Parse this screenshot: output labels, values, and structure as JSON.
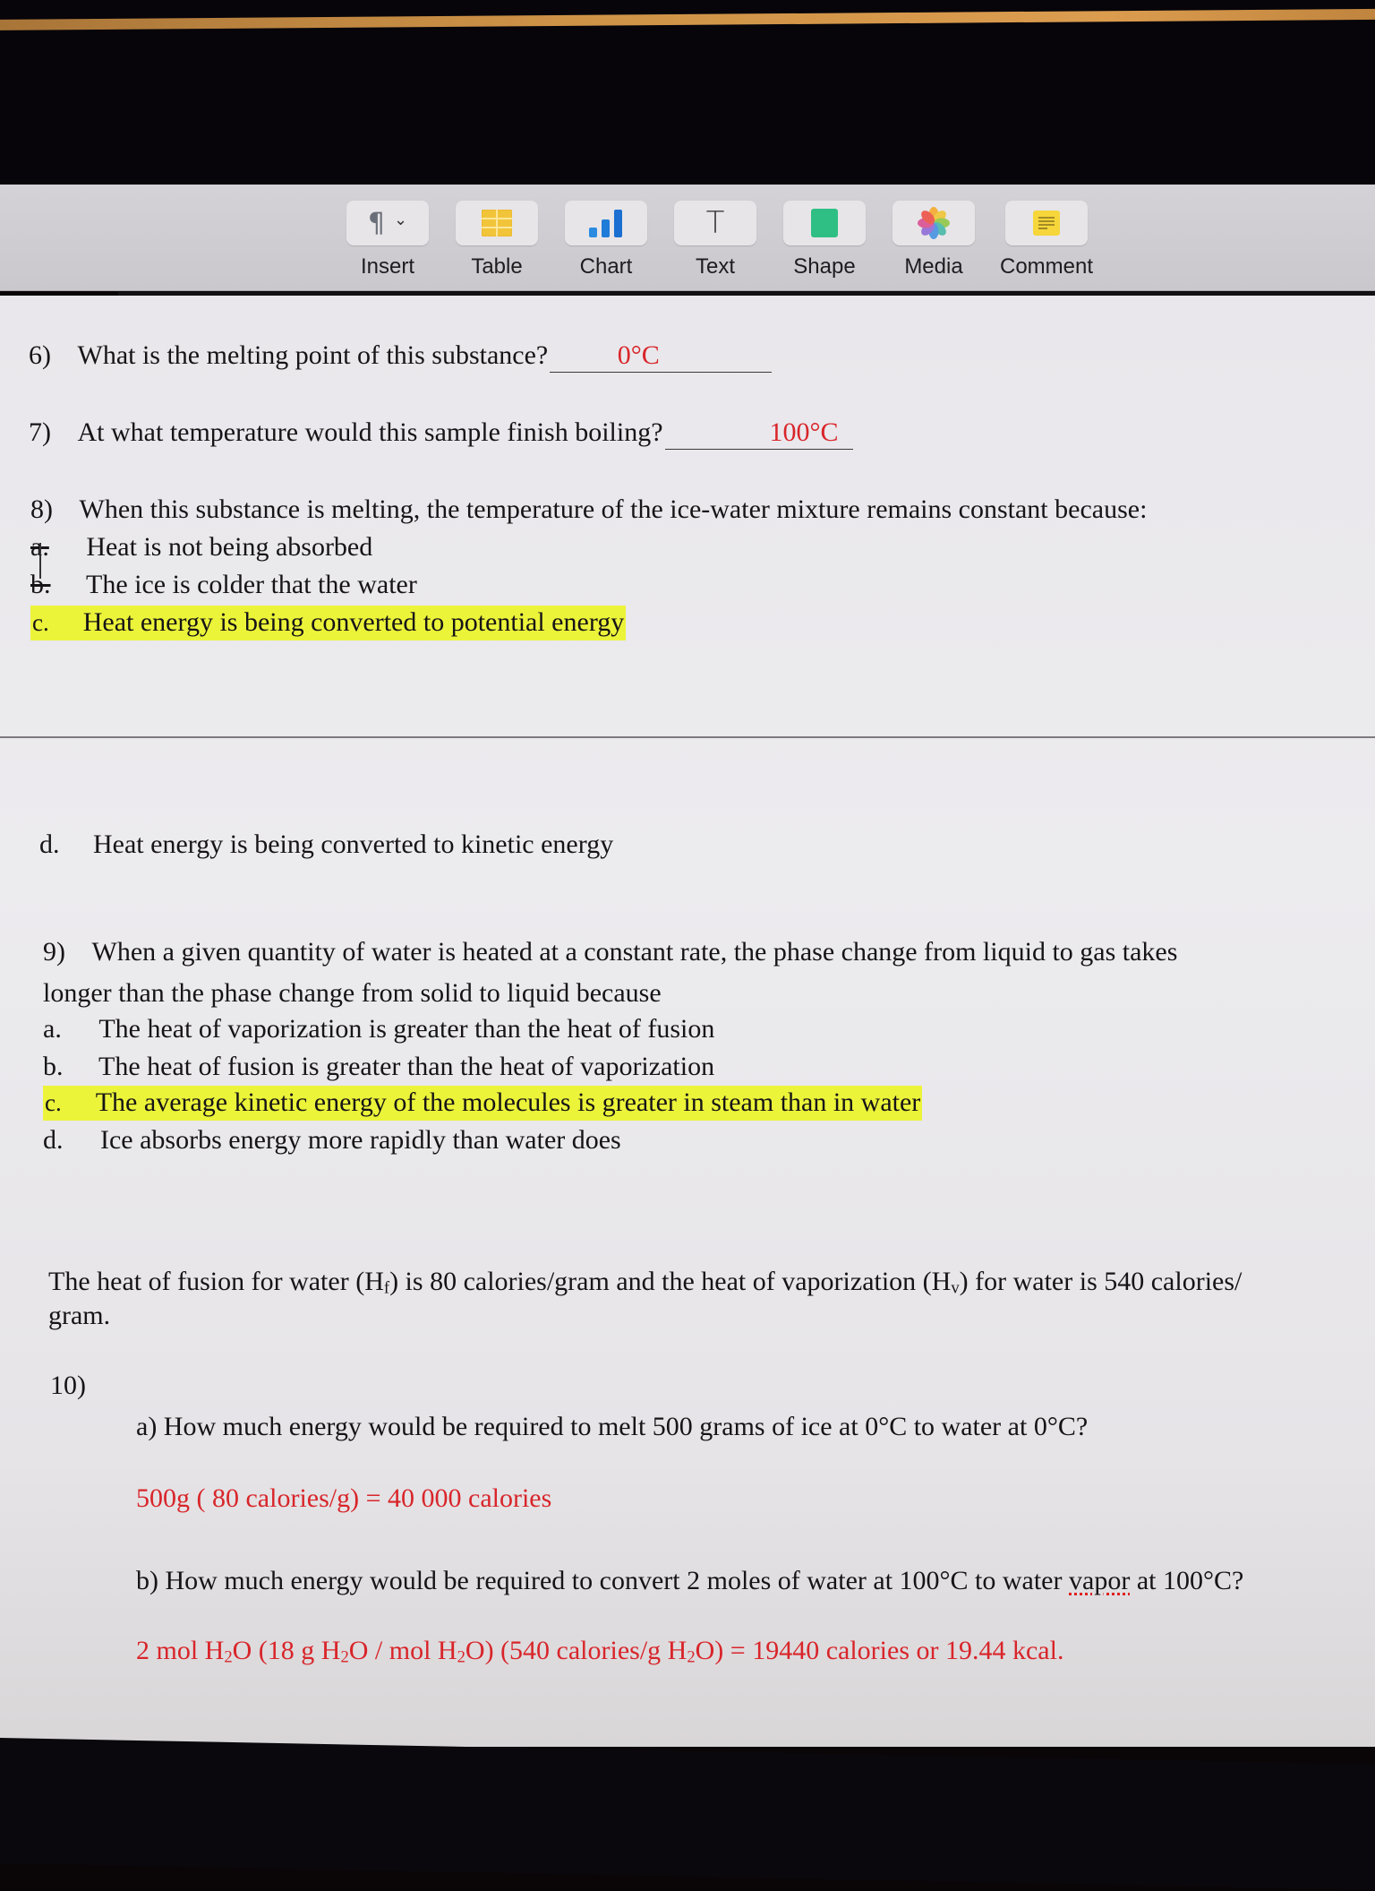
{
  "toolbar": {
    "items": [
      {
        "label": "Insert",
        "icon": "paragraph-icon"
      },
      {
        "label": "Table",
        "icon": "table-icon"
      },
      {
        "label": "Chart",
        "icon": "bar-chart-icon"
      },
      {
        "label": "Text",
        "icon": "text-icon"
      },
      {
        "label": "Shape",
        "icon": "shape-icon"
      },
      {
        "label": "Media",
        "icon": "photos-icon"
      },
      {
        "label": "Comment",
        "icon": "comment-note-icon"
      }
    ],
    "insert_glyph": "¶",
    "chevron_glyph": "⌄",
    "text_glyph": "T"
  },
  "colors": {
    "answer_red": "#d8252a",
    "highlight_yellow": "#ecf43a"
  },
  "questions": {
    "q6": {
      "number": "6)",
      "text": "What is the melting point of this substance?",
      "answer": "0°C"
    },
    "q7": {
      "number": "7)",
      "text": "At what temperature would this sample finish boiling?",
      "answer": "100°C"
    },
    "q8": {
      "number": "8)",
      "text": "When this substance is melting, the temperature of the ice-water mixture remains constant because:",
      "options": [
        {
          "letter": "a.",
          "text": "Heat is not being absorbed",
          "struck": true
        },
        {
          "letter": "b.",
          "text": "The ice is colder that the water",
          "struck": true
        },
        {
          "letter": "c.",
          "text": "Heat energy is being converted to potential energy",
          "highlighted": true
        },
        {
          "letter": "d.",
          "text": "Heat energy is being converted to kinetic energy"
        }
      ]
    },
    "q9": {
      "number": "9)",
      "text_line1": "When a given quantity of water is heated at a constant rate, the phase change from liquid to gas takes",
      "text_line2": "longer than the phase change from solid to liquid because",
      "options": [
        {
          "letter": "a.",
          "text": "The heat of vaporization is greater than the heat of fusion"
        },
        {
          "letter": "b.",
          "text": "The heat of fusion is greater than the heat of vaporization"
        },
        {
          "letter": "c.",
          "text": "The average kinetic energy of the molecules is greater in steam than in water",
          "highlighted": true
        },
        {
          "letter": "d.",
          "text": "Ice absorbs energy more rapidly than water does"
        }
      ]
    },
    "info": {
      "p1": "The heat of fusion for water (H",
      "sub_f": "f",
      "p2": ") is 80 calories/gram and the heat of vaporization (H",
      "sub_v": "v",
      "p3": ") for water is 540 calories/",
      "line2": "gram."
    },
    "q10": {
      "number": "10)",
      "a_question": "a) How much energy would be required to melt 500 grams of ice at 0°C to water at 0°C?",
      "a_answer": "500g ( 80 calories/g) = 40 000 calories",
      "b_question_pre": "b) How much energy would be required to convert 2 moles of water at 100°C to water ",
      "b_question_spell": "vapor",
      "b_question_post": " at 100°C?",
      "b_answer": {
        "s1": "2 mol H",
        "s2": "O  (18 g H",
        "s3": "O / mol H",
        "s4": "O)  (540 calories/g H",
        "s5": "O) = 19440 calories  or 19.44 kcal.",
        "sub2": "2"
      }
    }
  }
}
